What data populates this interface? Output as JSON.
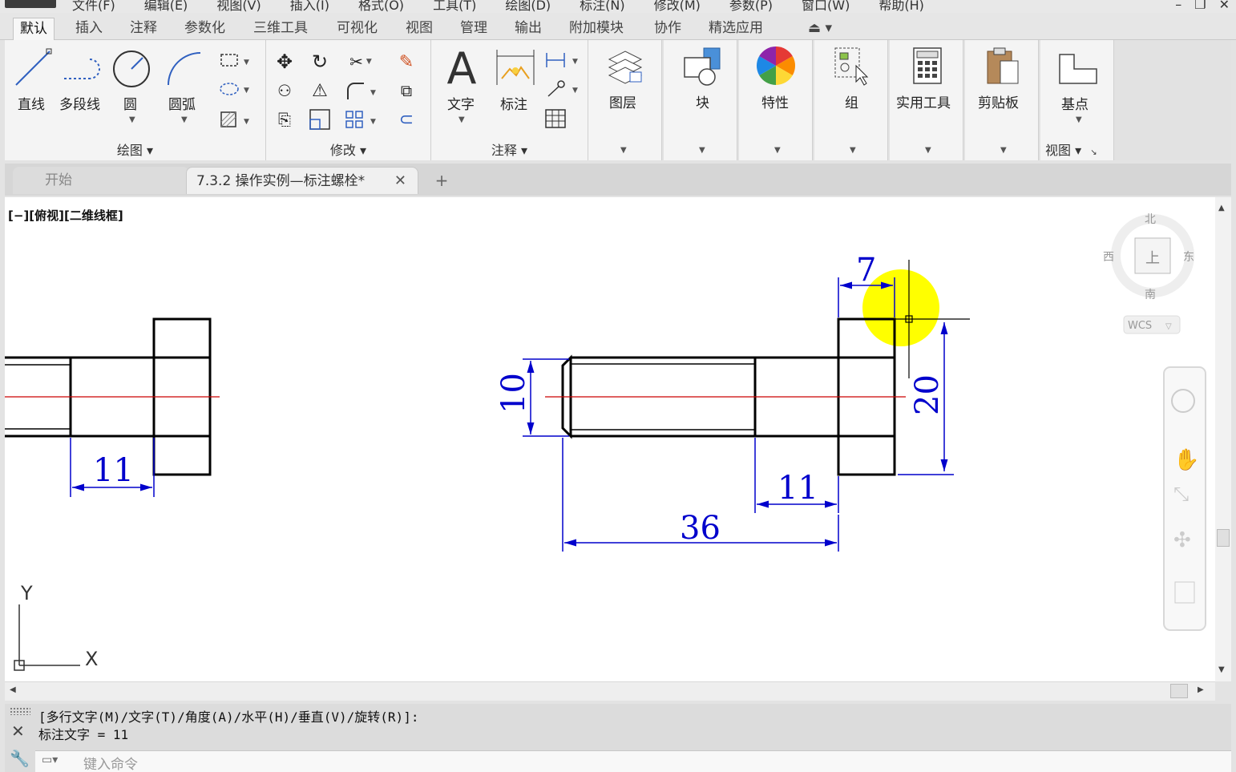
{
  "menu": {
    "items": [
      "文件(F)",
      "编辑(E)",
      "视图(V)",
      "插入(I)",
      "格式(O)",
      "工具(T)",
      "绘图(D)",
      "标注(N)",
      "修改(M)",
      "参数(P)",
      "窗口(W)",
      "帮助(H)"
    ]
  },
  "ribbon_tabs": [
    "默认",
    "插入",
    "注释",
    "参数化",
    "三维工具",
    "可视化",
    "视图",
    "管理",
    "输出",
    "附加模块",
    "协作",
    "精选应用"
  ],
  "panels": {
    "draw": {
      "title": "绘图",
      "tools": [
        "直线",
        "多段线",
        "圆",
        "圆弧"
      ]
    },
    "modify": {
      "title": "修改"
    },
    "annotation": {
      "title": "注释",
      "tools": [
        "文字",
        "标注"
      ]
    },
    "layers": {
      "label": "图层"
    },
    "block": {
      "label": "块"
    },
    "properties": {
      "label": "特性"
    },
    "group": {
      "label": "组"
    },
    "utilities": {
      "label": "实用工具"
    },
    "clipboard": {
      "label": "剪贴板"
    },
    "view": {
      "label": "基点",
      "title": "视图"
    }
  },
  "doc_tabs": {
    "start": "开始",
    "file": "7.3.2  操作实例—标注螺栓*",
    "close": "✕",
    "add": "+"
  },
  "viewport": {
    "label": "[−][俯视][二维线框]"
  },
  "viewcube": {
    "north": "北",
    "south": "南",
    "east": "东",
    "west": "西",
    "face": "上",
    "wcs": "WCS"
  },
  "ucs": {
    "x": "X",
    "y": "Y"
  },
  "drawing": {
    "dims": {
      "left_len": "11",
      "head_width": "7",
      "shank_dia": "10",
      "head_height": "20",
      "thread_len": "11",
      "total_len": "36"
    },
    "colors": {
      "outline": "#000000",
      "dimension": "#0000cc",
      "centerline": "#cc0000",
      "highlight": "#ffff00"
    }
  },
  "command": {
    "history": [
      "[多行文字(M)/文字(T)/角度(A)/水平(H)/垂直(V)/旋转(R)]:",
      "标注文字 = 11"
    ],
    "placeholder": "键入命令"
  }
}
